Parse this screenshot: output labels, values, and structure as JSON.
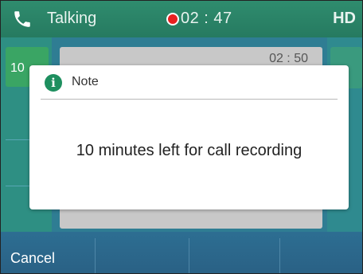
{
  "status_bar": {
    "call_state": "Talking",
    "recording_time": "02 : 47",
    "quality": "HD",
    "accent_color": "#2f8c6e",
    "recording_color": "#e82020",
    "icons": [
      "phone-icon",
      "record-icon"
    ]
  },
  "line_key": {
    "label": "10"
  },
  "call_card": {
    "duration": "02 : 50"
  },
  "dialog": {
    "title": "Note",
    "icon": "info-icon",
    "message": "10 minutes left for call recording"
  },
  "softkeys": {
    "cancel_label": "Cancel"
  }
}
